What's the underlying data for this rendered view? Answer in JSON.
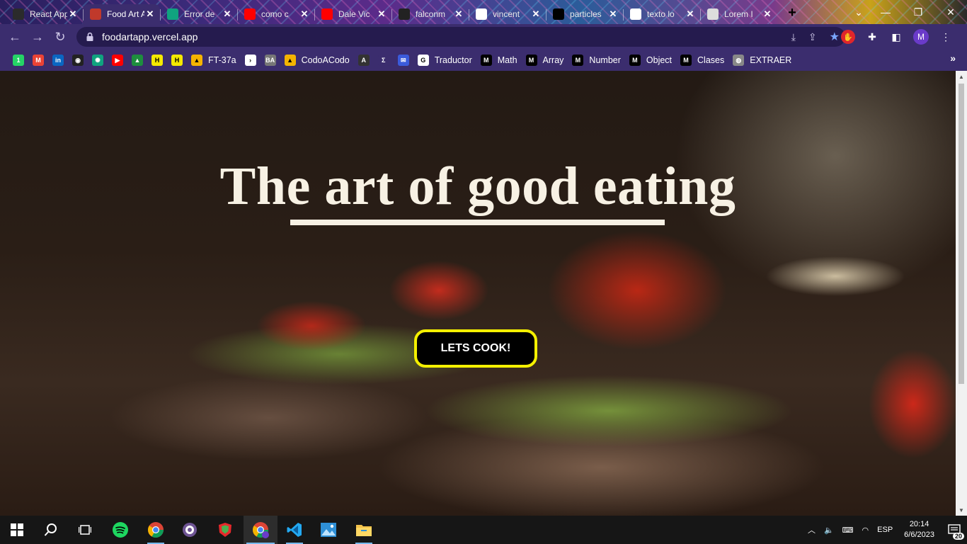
{
  "browser": {
    "tabs": [
      {
        "title": "React App",
        "icon": "react-icon",
        "color": "#2b2b2b"
      },
      {
        "title": "Food Art App",
        "icon": "food-icon",
        "color": "#c0392b"
      },
      {
        "title": "Error de",
        "icon": "chatgpt-icon",
        "color": "#10a37f"
      },
      {
        "title": "como c",
        "icon": "youtube-icon",
        "color": "#ff0000"
      },
      {
        "title": "Dale Vic",
        "icon": "youtube-icon",
        "color": "#ff0000"
      },
      {
        "title": "falconm",
        "icon": "github-icon",
        "color": "#222222"
      },
      {
        "title": "vincent",
        "icon": "google-icon",
        "color": "#ffffff"
      },
      {
        "title": "particles",
        "icon": "square-icon",
        "color": "#000000"
      },
      {
        "title": "texto lo",
        "icon": "google-icon",
        "color": "#ffffff"
      },
      {
        "title": "Lorem I",
        "icon": "lipsum-icon",
        "color": "#dddddd"
      }
    ],
    "active_tab_index": 1,
    "url": "foodartapp.vercel.app",
    "profile_initial": "M"
  },
  "bookmarks": [
    {
      "label": "",
      "icon": "whatsapp-icon",
      "color": "#25d366",
      "glyph": "1"
    },
    {
      "label": "",
      "icon": "gmail-icon",
      "color": "#ea4335",
      "glyph": "M"
    },
    {
      "label": "",
      "icon": "linkedin-icon",
      "color": "#0a66c2",
      "glyph": "in"
    },
    {
      "label": "",
      "icon": "github-icon",
      "color": "#222222",
      "glyph": "◉"
    },
    {
      "label": "",
      "icon": "chatgpt-icon",
      "color": "#10a37f",
      "glyph": "✺"
    },
    {
      "label": "",
      "icon": "youtube-icon",
      "color": "#ff0000",
      "glyph": "▶"
    },
    {
      "label": "",
      "icon": "classroom-icon",
      "color": "#1e8e3e",
      "glyph": "▲"
    },
    {
      "label": "",
      "icon": "henry-icon",
      "color": "#f4e900",
      "glyph": "H"
    },
    {
      "label": "",
      "icon": "henry-icon",
      "color": "#f4e900",
      "glyph": "H"
    },
    {
      "label": "FT-37a",
      "icon": "drive-icon",
      "color": "#f4b400",
      "glyph": "▲"
    },
    {
      "label": "",
      "icon": "terminal-icon",
      "color": "#ffffff",
      "glyph": "›"
    },
    {
      "label": "",
      "icon": "ba-icon",
      "color": "#777777",
      "glyph": "BA"
    },
    {
      "label": "CodoACodo",
      "icon": "drive-icon",
      "color": "#f4b400",
      "glyph": "▲"
    },
    {
      "label": "",
      "icon": "angular-icon",
      "color": "#333333",
      "glyph": "A"
    },
    {
      "label": "",
      "icon": "sigma-icon",
      "color": "#3b2d6e",
      "glyph": "Σ"
    },
    {
      "label": "",
      "icon": "mail-icon",
      "color": "#3b5bdb",
      "glyph": "✉"
    },
    {
      "label": "Traductor",
      "icon": "google-icon",
      "color": "#ffffff",
      "glyph": "G"
    },
    {
      "label": "Math",
      "icon": "mdn-icon",
      "color": "#000000",
      "glyph": "M"
    },
    {
      "label": "Array",
      "icon": "mdn-icon",
      "color": "#000000",
      "glyph": "M"
    },
    {
      "label": "Number",
      "icon": "mdn-icon",
      "color": "#000000",
      "glyph": "M"
    },
    {
      "label": "Object",
      "icon": "mdn-icon",
      "color": "#000000",
      "glyph": "M"
    },
    {
      "label": "Clases",
      "icon": "mdn-icon",
      "color": "#000000",
      "glyph": "M"
    },
    {
      "label": "EXTRAER",
      "icon": "globe-icon",
      "color": "#888888",
      "glyph": "◍"
    }
  ],
  "page": {
    "hero_title": "The art of good eating",
    "cta_label": "LETS COOK!",
    "accent_color": "#f4f000"
  },
  "taskbar": {
    "language": "ESP",
    "time": "20:14",
    "date": "6/6/2023",
    "notification_count": "20"
  }
}
